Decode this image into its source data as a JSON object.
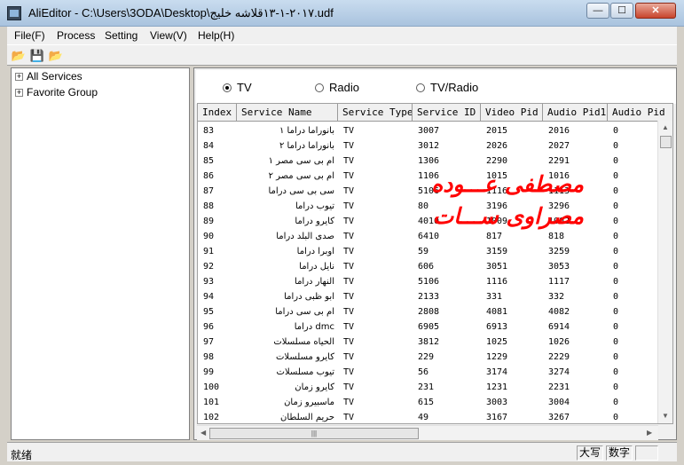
{
  "window": {
    "title": "AliEditor - C:\\Users\\3ODA\\Desktop\\٢٠١٧-١-١٣قلاشه خليج.udf",
    "minimize_glyph": "—",
    "maximize_glyph": "☐",
    "close_glyph": "✕"
  },
  "menu": [
    "File(F)",
    "Process",
    "Setting",
    "View(V)",
    "Help(H)"
  ],
  "toolbar": {
    "icons": [
      "open-folder-icon",
      "save-icon",
      "open-folder-icon"
    ],
    "glyphs": [
      "📂",
      "💾",
      "📂"
    ]
  },
  "tree": {
    "expander_glyph": "+",
    "items": [
      "All Services",
      "Favorite Group"
    ]
  },
  "filter": {
    "options": [
      "TV",
      "Radio",
      "TV/Radio"
    ],
    "selected": "TV"
  },
  "table": {
    "columns": [
      "Index",
      "Service Name",
      "Service Type",
      "Service ID",
      "Video Pid",
      "Audio Pid1",
      "Audio Pid"
    ],
    "rows": [
      [
        "83",
        "بانوراما دراما ١",
        "TV",
        "3007",
        "2015",
        "2016",
        "0"
      ],
      [
        "84",
        "بانوراما دراما ٢",
        "TV",
        "3012",
        "2026",
        "2027",
        "0"
      ],
      [
        "85",
        "ام بى سى مصر ١",
        "TV",
        "1306",
        "2290",
        "2291",
        "0"
      ],
      [
        "86",
        "ام بى سى مصر ٢",
        "TV",
        "1106",
        "1015",
        "1016",
        "0"
      ],
      [
        "87",
        "سى بى سى دراما",
        "TV",
        "5106",
        "1116",
        "1113",
        "0"
      ],
      [
        "88",
        "تيوب دراما",
        "TV",
        "80",
        "3196",
        "3296",
        "0"
      ],
      [
        "89",
        "كايرو دراما",
        "TV",
        "4010",
        "1009",
        "1002",
        "0"
      ],
      [
        "90",
        "صدى البلد دراما",
        "TV",
        "6410",
        "817",
        "818",
        "0"
      ],
      [
        "91",
        "اوبرا دراما",
        "TV",
        "59",
        "3159",
        "3259",
        "0"
      ],
      [
        "92",
        "نايل دراما",
        "TV",
        "606",
        "3051",
        "3053",
        "0"
      ],
      [
        "93",
        "النهار دراما",
        "TV",
        "5106",
        "1116",
        "1117",
        "0"
      ],
      [
        "94",
        "ابو ظبى دراما",
        "TV",
        "2133",
        "331",
        "332",
        "0"
      ],
      [
        "95",
        "ام بى سى دراما",
        "TV",
        "2808",
        "4081",
        "4082",
        "0"
      ],
      [
        "96",
        "dmc دراما",
        "TV",
        "6905",
        "6913",
        "6914",
        "0"
      ],
      [
        "97",
        "الحياه مسلسلات",
        "TV",
        "3812",
        "1025",
        "1026",
        "0"
      ],
      [
        "98",
        "كايرو مسلسلات",
        "TV",
        "229",
        "1229",
        "2229",
        "0"
      ],
      [
        "99",
        "تيوب مسلسلات",
        "TV",
        "56",
        "3174",
        "3274",
        "0"
      ],
      [
        "100",
        "كايرو زمان",
        "TV",
        "231",
        "1231",
        "2231",
        "0"
      ],
      [
        "101",
        "ماسبيرو زمان",
        "TV",
        "615",
        "3003",
        "3004",
        "0"
      ],
      [
        "102",
        "حريم السلطان",
        "TV",
        "49",
        "3167",
        "3267",
        "0"
      ]
    ]
  },
  "watermark": {
    "line1": "مصطفى عـــوده",
    "line2": "مصراوى ســـات",
    "color": "#ff0000"
  },
  "scrollbars": {
    "up": "▲",
    "down": "▼",
    "left": "◀",
    "right": "▶",
    "grip": "|||"
  },
  "status": {
    "text": "就绪",
    "caps": "大写",
    "num": "数字",
    "scrl": ""
  }
}
